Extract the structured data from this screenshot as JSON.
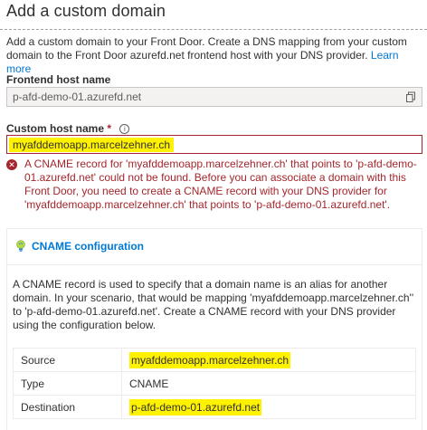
{
  "page": {
    "title": "Add a custom domain",
    "intro": "Add a custom domain to your Front Door. Create a DNS mapping from your custom domain to the Front Door azurefd.net frontend host with your DNS provider.",
    "learn_more": "Learn more"
  },
  "frontend": {
    "label": "Frontend host name",
    "value": "p-afd-demo-01.azurefd.net",
    "copy_icon": "copy-icon"
  },
  "custom_host": {
    "label": "Custom host name",
    "required_mark": "*",
    "info_icon": "info-icon",
    "value": "myafddemoapp.marcelzehner.ch",
    "error": "A CNAME record for 'myafddemoapp.marcelzehner.ch' that points to 'p-afd-demo-01.azurefd.net' could not be found. Before you can associate a domain with this Front Door, you need to create a CNAME record with your DNS provider for 'myafddemoapp.marcelzehner.ch' that points to 'p-afd-demo-01.azurefd.net'.",
    "error_icon": "error-icon"
  },
  "cname": {
    "title": "CNAME configuration",
    "icon": "lightbulb-icon",
    "description": "A CNAME record is used to specify that a domain name is an alias for another domain. In your scenario, that would be mapping 'myafddemoapp.marcelzehner.ch'' to 'p-afd-demo-01.azurefd.net'. Create a CNAME record with your DNS provider using the configuration below.",
    "rows": [
      {
        "key": "Source",
        "value": "myafddemoapp.marcelzehner.ch"
      },
      {
        "key": "Type",
        "value": "CNAME"
      },
      {
        "key": "Destination",
        "value": "p-afd-demo-01.azurefd.net"
      }
    ]
  },
  "colors": {
    "accent": "#0078d4",
    "error": "#a4262c",
    "highlight": "#fff200"
  }
}
